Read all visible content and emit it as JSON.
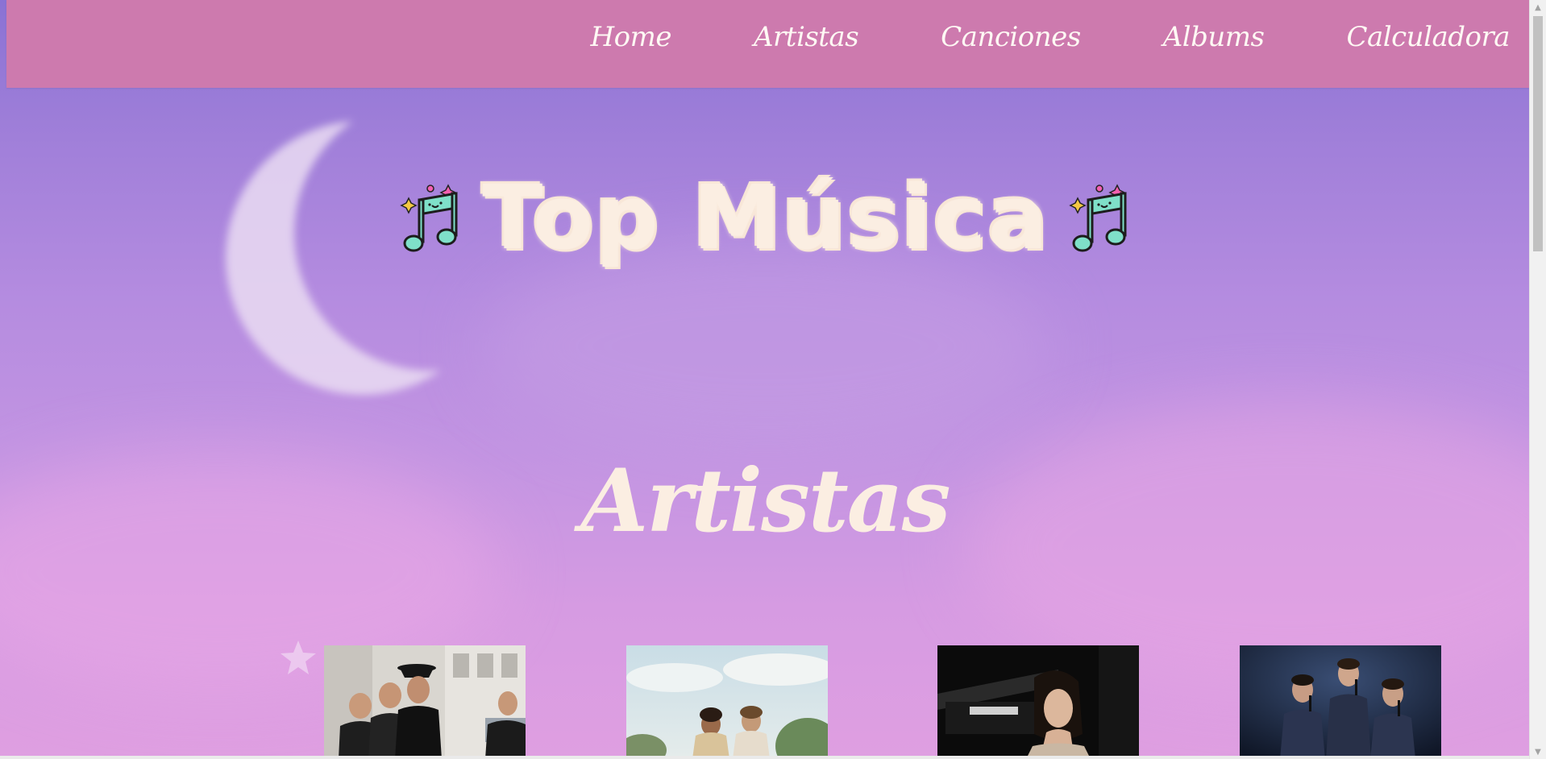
{
  "nav": {
    "items": [
      {
        "label": "Home"
      },
      {
        "label": "Artistas"
      },
      {
        "label": "Canciones"
      },
      {
        "label": "Albums"
      },
      {
        "label": "Calculadora"
      }
    ]
  },
  "hero": {
    "title": "Top Música",
    "left_icon": "music-note-icon",
    "right_icon": "music-note-icon"
  },
  "section": {
    "title": "Artistas"
  },
  "artists": {
    "images": [
      {
        "alt_icon": "band-photo"
      },
      {
        "alt_icon": "duo-photo"
      },
      {
        "alt_icon": "singer-photo"
      },
      {
        "alt_icon": "trio-photo"
      }
    ]
  },
  "colors": {
    "navbar": "#cd7aae",
    "title_cream": "#fbeee2",
    "sky_top": "#8a72d4",
    "sky_bottom": "#df9fe1"
  }
}
